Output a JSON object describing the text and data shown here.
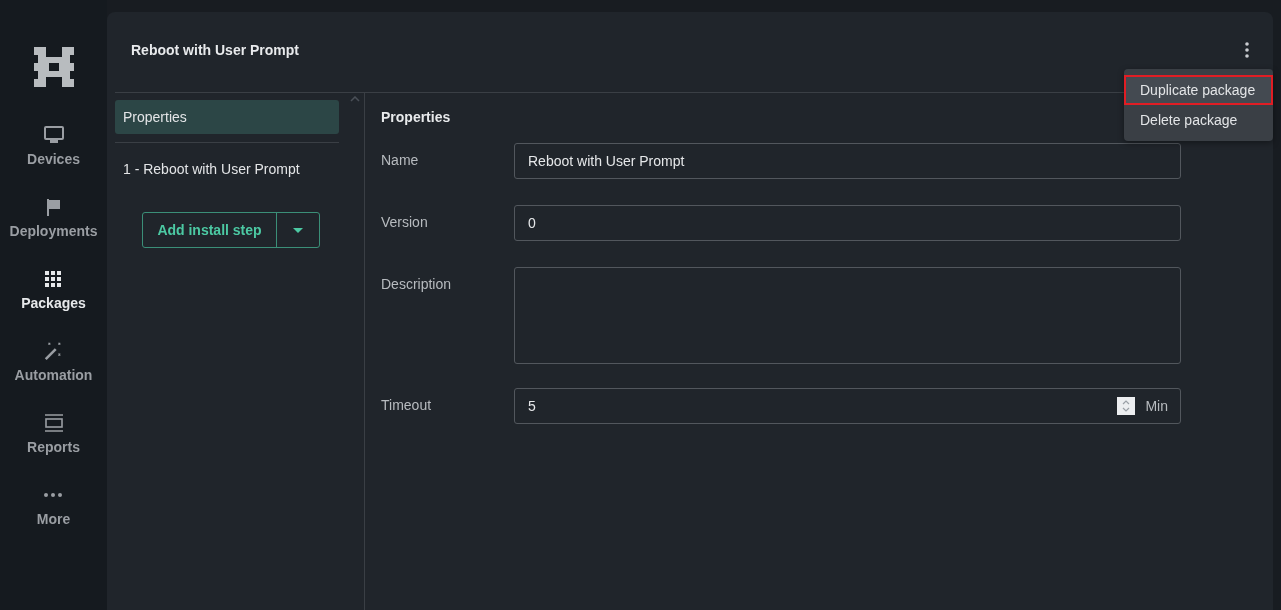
{
  "nav": [
    {
      "label": "Devices",
      "selected": false
    },
    {
      "label": "Deployments",
      "selected": false
    },
    {
      "label": "Packages",
      "selected": true
    },
    {
      "label": "Automation",
      "selected": false
    },
    {
      "label": "Reports",
      "selected": false
    },
    {
      "label": "More",
      "selected": false
    }
  ],
  "header": {
    "title": "Reboot with User Prompt"
  },
  "menu": [
    {
      "label": "Duplicate package",
      "selected": true
    },
    {
      "label": "Delete package",
      "selected": false
    }
  ],
  "steps": [
    {
      "label": "Properties",
      "selected": true
    },
    {
      "label": "1 - Reboot with User Prompt",
      "selected": false
    }
  ],
  "add_button": {
    "label": "Add install step"
  },
  "form": {
    "title": "Properties",
    "fields": [
      {
        "kind": "text",
        "label": "Name",
        "value": "Reboot with User Prompt"
      },
      {
        "kind": "text",
        "label": "Version",
        "value": "0"
      },
      {
        "kind": "textarea",
        "label": "Description"
      },
      {
        "kind": "number",
        "label": "Timeout",
        "value": "5",
        "unit": "Min"
      }
    ]
  }
}
